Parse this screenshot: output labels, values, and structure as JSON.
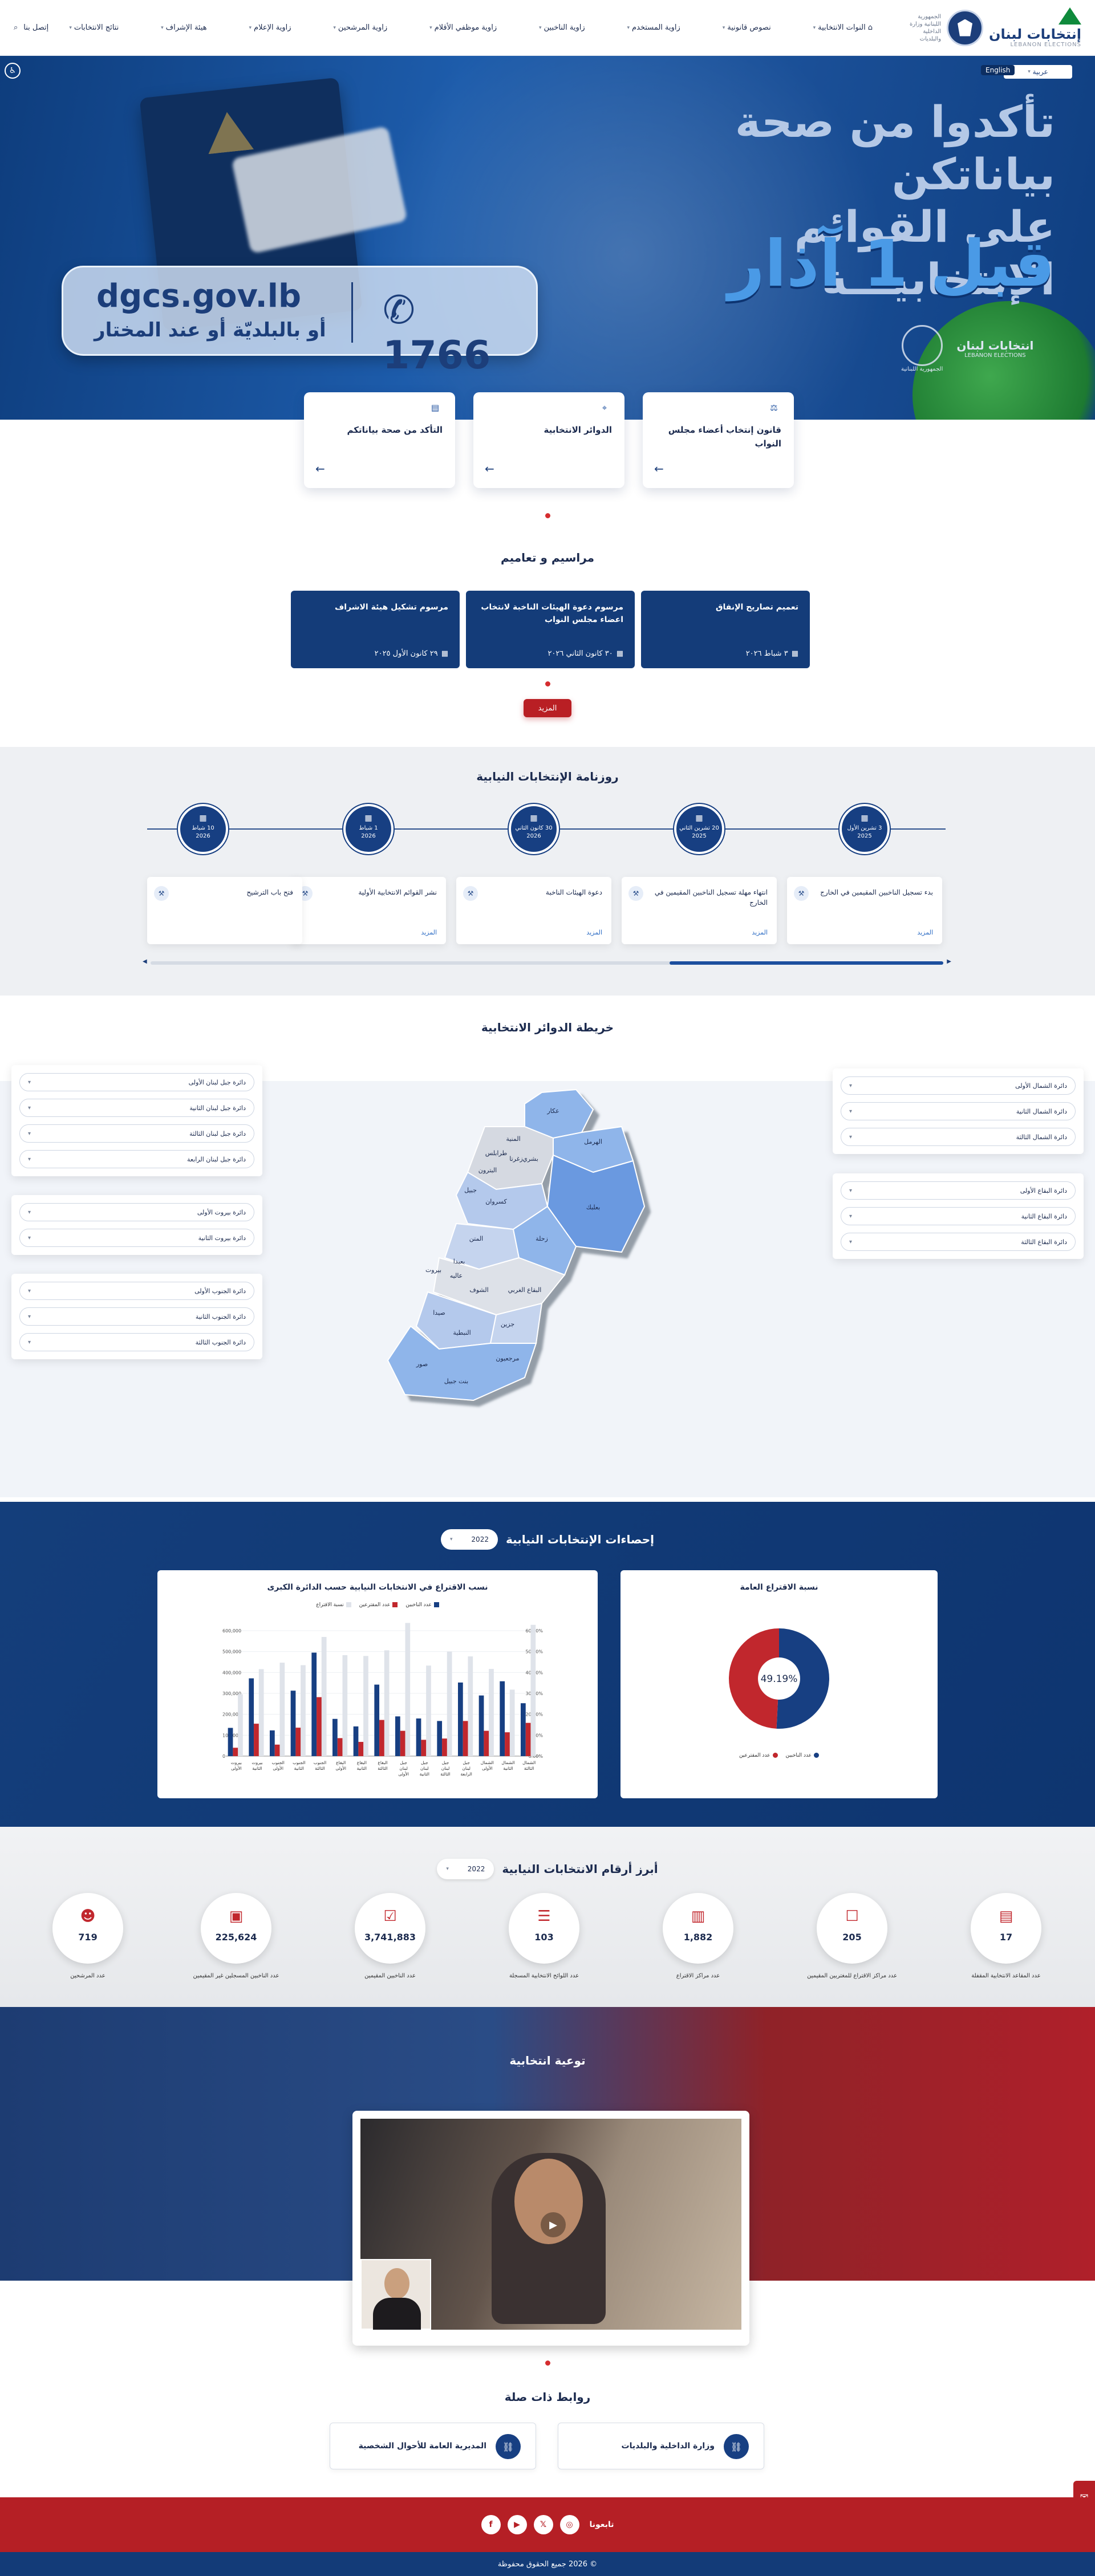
{
  "header": {
    "brand_title": "إنتخابات لبنان",
    "brand_sub": "LEBANON ELECTIONS",
    "ministry": "الجمهورية اللبنانية وزارة الداخلية والبلديات",
    "nav": [
      "انتخابات",
      "نصوص قانونية",
      "زاوية المستخدم",
      "زاوية الناخبين",
      "زاوية موظفي الأقلام",
      "زاوية المرشحين",
      "زاوية الإعلام",
      "هيئة الإشراف",
      "نتائج الانتخابات"
    ],
    "home_label": "",
    "home_nav": "النوات الانتخابية",
    "contact": "إتصل بنا",
    "lang": "عربية",
    "lang_other": "English"
  },
  "hero": {
    "line1": "تأكدوا من صحة بياناتكن",
    "line2": "على القوائم الإنتخابيـــة",
    "line3": "قبل 1 آذار",
    "url": "dgcs.gov.lb",
    "alt": "أو بالبلديّة أو عند المختار",
    "phone": "1766",
    "logo1": "انتخابات لبنان",
    "logo1_sub": "LEBANON ELECTIONS",
    "logo2": "الجمهورية اللبنانية"
  },
  "quick_cards": [
    {
      "title": "قانون إنتخاب أعضاء مجلس النواب",
      "icon": "scale-icon"
    },
    {
      "title": "الدوائر الانتخابية",
      "icon": "map-pin-icon"
    },
    {
      "title": "التأكد من صحة بياناتكم",
      "icon": "document-icon"
    }
  ],
  "decrees": {
    "title": "مراسيم و تعاميم",
    "items": [
      {
        "title": "تعميم تصاريح الإنفاق",
        "date": "٣ شباط ٢٠٢٦"
      },
      {
        "title": "مرسوم دعوة الهيئات الناخبة لانتخاب اعضاء مجلس النواب",
        "date": "٣٠ كانون الثاني ٢٠٢٦"
      },
      {
        "title": "مرسوم تشكيل هيئة الاشراف",
        "date": "٢٩ كانون الأول ٢٠٢٥"
      }
    ],
    "more": "المزيد"
  },
  "calendar": {
    "title": "روزنامة الإنتخابات النيابية",
    "events": [
      {
        "day": "3 تشرين الأول",
        "year": "2025",
        "text": "بدء تسجيل الناخبين المقيمين في الخارج",
        "link": "المزيد"
      },
      {
        "day": "20 تشرين الثاني",
        "year": "2025",
        "text": "انتهاء مهلة تسجيل الناخبين المقيمين في الخارج",
        "link": "المزيد"
      },
      {
        "day": "30 كانون الثاني",
        "year": "2026",
        "text": "دعوة الهيئات الناخبة",
        "link": "المزيد"
      },
      {
        "day": "1 شباط",
        "year": "2026",
        "text": "نشر القوائم الانتخابية الأولية",
        "link": "المزيد"
      },
      {
        "day": "10 شباط",
        "year": "2026",
        "text": "فتح باب الترشيح",
        "link": ""
      }
    ]
  },
  "map": {
    "title": "خريطة الدوائر الانتخابية",
    "right_groups": [
      [
        "دائرة الشمال الأولى",
        "دائرة الشمال الثانية",
        "دائرة الشمال الثالثة"
      ],
      [
        "دائرة البقاع الأولى",
        "دائرة البقاع الثانية",
        "دائرة البقاع الثالثة"
      ]
    ],
    "left_groups": [
      [
        "دائرة جبل لبنان الأولى",
        "دائرة جبل لبنان الثانية",
        "دائرة جبل لبنان الثالثة",
        "دائرة جبل لبنان الرابعة"
      ],
      [
        "دائرة بيروت الأولى",
        "دائرة بيروت الثانية"
      ],
      [
        "دائرة الجنوب الأولى",
        "دائرة الجنوب الثانية",
        "دائرة الجنوب الثالثة"
      ]
    ],
    "district_labels": [
      "عكار",
      "المنية",
      "طرابلس",
      "البترون",
      "زغرتا",
      "بشري",
      "الهرمل",
      "جبيل",
      "بعلبك",
      "كسروان",
      "المتن",
      "زحلة",
      "بعبدا",
      "عاليه",
      "الشوف",
      "البقاع الغربي",
      "صيدا",
      "جزين",
      "النبطية",
      "صور",
      "مرجعيون",
      "بنت جبيل",
      "بيروت"
    ]
  },
  "stats": {
    "title": "إحصاءات الإنتخابات النيابية",
    "year": "2022",
    "pie_title": "نسبة الاقتراع العامة",
    "pie_value": "49.19%",
    "pie_legend": [
      "عدد الناخبين",
      "عدد المقترعين"
    ],
    "bar_title": "نسب الاقتراع في الانتخابات النيابية حسب الدائرة الكبرى",
    "bar_legend": [
      "عدد الناخبين",
      "عدد المقترعين",
      "نسبة الاقتراع"
    ]
  },
  "chart_data": {
    "type": "bar",
    "title": "نسب الاقتراع في الانتخابات النيابية حسب الدائرة الكبرى",
    "categories": [
      "بيروت الأولى",
      "بيروت الثانية",
      "الجنوب الأولى",
      "الجنوب الثانية",
      "الجنوب الثالثة",
      "البقاع الأولى",
      "البقاع الثانية",
      "البقاع الثالثة",
      "جبل لبنان الأولى",
      "جبل لبنان الثانية",
      "جبل لبنان الثالثة",
      "جبل لبنان الرابعة",
      "الشمال الأولى",
      "الشمال الثانية",
      "الشمال الثالثة"
    ],
    "series": [
      {
        "name": "عدد الناخبين",
        "color": "#173f82",
        "values": [
          135000,
          372000,
          123000,
          313000,
          495000,
          178000,
          142000,
          342000,
          190000,
          180000,
          168000,
          352000,
          290000,
          358000,
          253000
        ]
      },
      {
        "name": "عدد المقترعين",
        "color": "#c1272d",
        "values": [
          40000,
          155000,
          55000,
          136000,
          282000,
          86000,
          68000,
          173000,
          121000,
          78000,
          84000,
          168000,
          121000,
          114000,
          159000
        ]
      },
      {
        "name": "نسبة الاقتراع",
        "color": "#dfe3ea",
        "values": [
          29.6,
          41.6,
          44.7,
          43.5,
          57.0,
          48.3,
          47.9,
          50.6,
          63.7,
          43.3,
          50.0,
          47.7,
          41.7,
          31.8,
          62.8
        ]
      }
    ],
    "ylim": [
      0,
      600000
    ],
    "y2lim": [
      0,
      60
    ],
    "yticks": [
      "0",
      "100,000",
      "200,000",
      "300,000",
      "400,000",
      "500,000",
      "600,000"
    ],
    "y2ticks": [
      "0.00%",
      "10.00%",
      "20.00%",
      "30.00%",
      "40.00%",
      "50.00%",
      "60.00%"
    ],
    "pie": {
      "values": [
        50.81,
        49.19
      ],
      "labels": [
        "عدد الناخبين",
        "عدد المقترعين"
      ]
    }
  },
  "numbers": {
    "title": "أبرز أرقام الانتخابات النيابية",
    "year": "2022",
    "items": [
      {
        "value": "17",
        "label": "عدد المقاعد الانتخابية المقفلة",
        "icon": "document-icon"
      },
      {
        "value": "205",
        "label": "عدد مراكز الاقتراع للمغتربين المقيمين",
        "icon": "ballot-box-icon"
      },
      {
        "value": "1,882",
        "label": "عدد مراكز الاقتراع",
        "icon": "building-icon"
      },
      {
        "value": "103",
        "label": "عدد اللوائح الانتخابية المسجلة",
        "icon": "list-icon"
      },
      {
        "value": "3,741,883",
        "label": "عدد الناخبين المقيمين",
        "icon": "checklist-icon"
      },
      {
        "value": "225,624",
        "label": "عدد الناخبين المسجلين غير المقيمين",
        "icon": "id-card-icon"
      },
      {
        "value": "719",
        "label": "عدد المرشحين",
        "icon": "people-icon"
      }
    ]
  },
  "awareness": {
    "title": "توعية انتخابية"
  },
  "links": {
    "title": "روابط ذات صلة",
    "items": [
      "وزارة الداخلية والبلديات",
      "المديرية العامة للأحوال الشخصية"
    ]
  },
  "footer": {
    "follow": "تابعونا",
    "copyright": "© 2026 جميع الحقوق محفوظة"
  }
}
